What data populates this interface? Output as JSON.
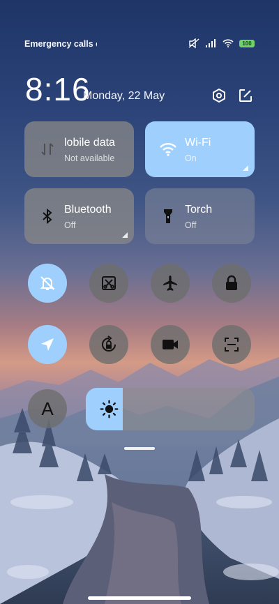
{
  "status_bar": {
    "carrier_text": "Emergency calls o",
    "battery": "100",
    "icons": [
      "mute-icon",
      "signal-icon",
      "wifi-icon",
      "battery-icon"
    ]
  },
  "header": {
    "time": "8:16",
    "date": "Monday, 22 May",
    "settings_icon": "settings-hex-icon",
    "edit_icon": "edit-icon"
  },
  "tiles": {
    "mobile_data": {
      "title": "lobile data",
      "subtitle": "Not available",
      "icon": "mobile-data-icon"
    },
    "wifi": {
      "title": "Wi-Fi",
      "subtitle": "On",
      "icon": "wifi-icon",
      "active": true
    },
    "bluetooth": {
      "title": "Bluetooth",
      "subtitle": "Off",
      "icon": "bluetooth-icon"
    },
    "torch": {
      "title": "Torch",
      "subtitle": "Off",
      "icon": "torch-icon"
    }
  },
  "toggles": [
    {
      "name": "silent",
      "icon": "bell-off-icon",
      "active": true
    },
    {
      "name": "screenshot",
      "icon": "screenshot-icon",
      "active": false
    },
    {
      "name": "airplane",
      "icon": "airplane-icon",
      "active": false
    },
    {
      "name": "lock",
      "icon": "lock-icon",
      "active": false
    },
    {
      "name": "location",
      "icon": "location-icon",
      "active": true
    },
    {
      "name": "rotation-lock",
      "icon": "rotation-lock-icon",
      "active": false
    },
    {
      "name": "screen-record",
      "icon": "video-camera-icon",
      "active": false
    },
    {
      "name": "scanner",
      "icon": "scan-icon",
      "active": false
    }
  ],
  "font_size_label": "A",
  "brightness": {
    "level": 0.22,
    "icon": "sun-icon"
  },
  "colors": {
    "active": "#9fd0fd",
    "inactive": "#6e6e6e",
    "battery": "#6fd36a"
  }
}
